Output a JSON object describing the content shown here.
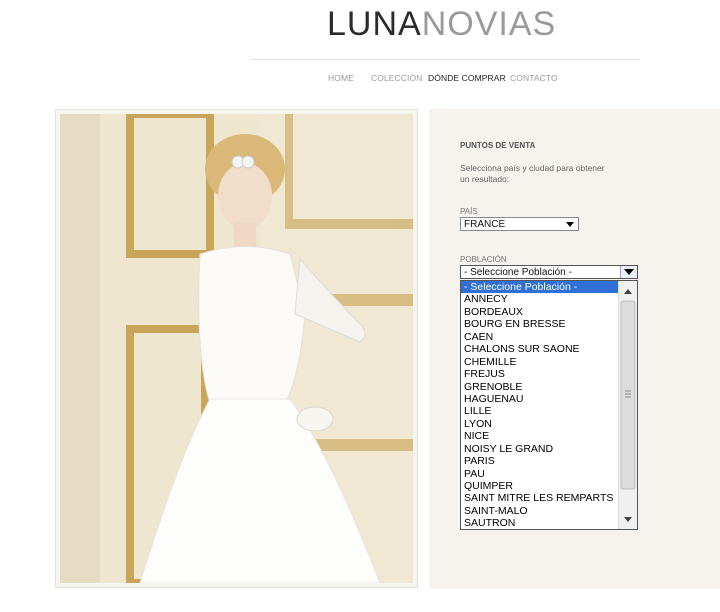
{
  "logo": {
    "part1": "LUNA",
    "part2": "NOVIAS"
  },
  "nav": [
    {
      "label": "HOME"
    },
    {
      "label": "COLECCIÓN"
    },
    {
      "label": "DÓNDE COMPRAR"
    },
    {
      "label": "CONTACTO"
    }
  ],
  "panel": {
    "title": "PUNTOS DE VENTA",
    "description": "Selecciona país y ciudad para obtener un resultado:",
    "country_label": "PAÍS",
    "country_value": "FRANCE",
    "city_label": "POBLACIÓN",
    "city_value": "- Seleccione Población -"
  },
  "dropdown": {
    "options": [
      "- Seleccione Población -",
      "ANNECY",
      "BORDEAUX",
      "BOURG EN BRESSE",
      "CAEN",
      "CHALONS SUR SAONE",
      "CHEMILLE",
      "FREJUS",
      "GRENOBLE",
      "HAGUENAU",
      "LILLE",
      "LYON",
      "NICE",
      "NOISY LE GRAND",
      "PARIS",
      "PAU",
      "QUIMPER",
      "SAINT MITRE LES REMPARTS",
      "SAINT-MALO",
      "SAUTRON"
    ],
    "selected_index": 0
  },
  "colors": {
    "selected_option": "#2f6fd6",
    "panel_bg": "#f6f3ef",
    "logo_dark": "#2b2b2b",
    "logo_light": "#9a9a9a"
  }
}
